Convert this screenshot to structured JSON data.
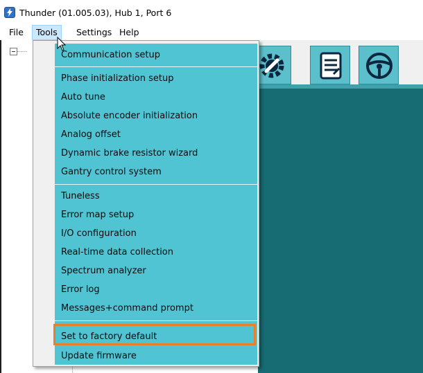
{
  "window": {
    "title": "Thunder (01.005.03), Hub 1, Port 6"
  },
  "menubar": {
    "items": [
      "File",
      "Tools",
      "Settings",
      "Help"
    ],
    "active": "Tools"
  },
  "toolbar": {
    "buttons": [
      "wrench-gear-icon",
      "notepad-icon",
      "steering-wheel-icon"
    ]
  },
  "tools_menu": {
    "groups": [
      [
        "Communication setup"
      ],
      [
        "Phase initialization setup",
        "Auto tune",
        "Absolute encoder initialization",
        "Analog offset",
        "Dynamic brake resistor wizard",
        "Gantry control system"
      ],
      [
        "Tuneless",
        "Error map setup",
        "I/O configuration",
        "Real-time data collection",
        "Spectrum analyzer",
        "Error log",
        "Messages+command prompt"
      ],
      [
        "Set to factory default",
        "Update firmware"
      ]
    ],
    "highlighted": "Set to factory default",
    "highlight_color": "#e5812f",
    "menu_color": "#50c4d2"
  },
  "colors": {
    "content_bg": "#176b73",
    "menu_active_bg": "#cce8ff"
  }
}
